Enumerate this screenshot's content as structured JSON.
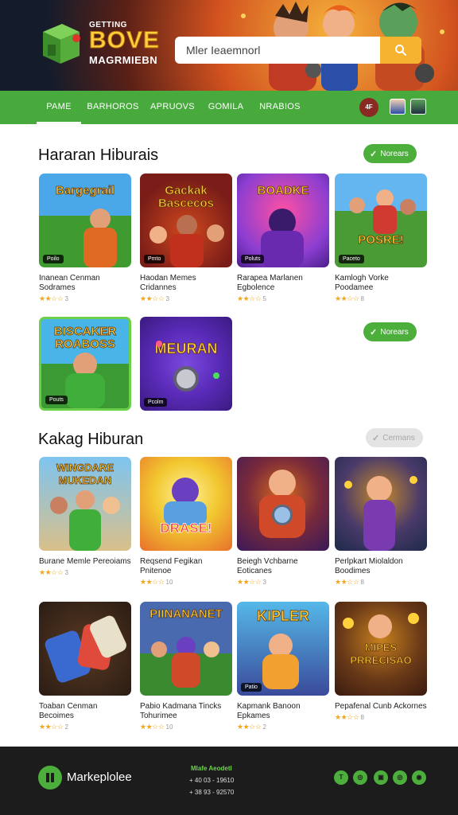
{
  "header": {
    "logo_small": "GETTING",
    "logo_big": "BOVE",
    "logo_sub": "MAGRMIEBN",
    "search_placeholder": "Mler Ieaemnorl"
  },
  "nav": {
    "items": [
      {
        "label": "PAME",
        "active": true
      },
      {
        "label": "BARHOROS",
        "active": false
      },
      {
        "label": "APRUOVS",
        "active": false
      },
      {
        "label": "GOMILA",
        "active": false
      },
      {
        "label": "NRABIOS",
        "active": false
      }
    ],
    "badge": "4F"
  },
  "section1": {
    "title": "Hararan Hiburais",
    "pill_label": "Norears",
    "pill2_label": "Norears",
    "cards": [
      {
        "thumb_title": "Bargegrail",
        "tag": "Poilo",
        "name": "Inanean Cenman Sodrames",
        "rating": "3",
        "colors": [
          "#4aa8e8",
          "#3f9b2f"
        ]
      },
      {
        "thumb_title": "Gackak Bascecos",
        "tag": "Pmto",
        "name": "Haodan Memes Cridannes",
        "rating": "3",
        "colors": [
          "#7a1d18",
          "#d0481d"
        ]
      },
      {
        "thumb_title": "BOADKE",
        "tag": "Poluts",
        "name": "Rarapea Marlanen Egbolence",
        "rating": "5",
        "colors": [
          "#8b3ed1",
          "#ff4fa3"
        ]
      },
      {
        "thumb_title": "POSRE!",
        "tag": "Paceto",
        "name": "Kamlogh Vorke Poodamee",
        "rating": "8",
        "colors": [
          "#64b6f0",
          "#4a9a35"
        ]
      },
      {
        "thumb_title": "BISCAKER ROABOSS",
        "tag": "Pouts",
        "name": "",
        "rating": "",
        "colors": [
          "#48b4e8",
          "#3c9a34"
        ]
      },
      {
        "thumb_title": "MEURAN",
        "tag": "Pcolm",
        "name": "",
        "rating": "",
        "colors": [
          "#5a2bb8",
          "#3a1a80"
        ]
      }
    ]
  },
  "section2": {
    "title": "Kakag Hiburan",
    "pill_label": "Cermans",
    "cards": [
      {
        "thumb_title": "WINGDARE MUKEDAN",
        "tag": "",
        "name": "Burane Memle Pereoiams",
        "rating": "3",
        "colors": [
          "#7ec4f0",
          "#d9c08a"
        ]
      },
      {
        "thumb_title": "DRASE!",
        "tag": "",
        "name": "Reqsend Fegikan Pnitenoe",
        "rating": "10",
        "colors": [
          "#f2c830",
          "#e8702a"
        ]
      },
      {
        "thumb_title": "",
        "tag": "",
        "name": "Beiegh Vchbarne Eoticanes",
        "rating": "3",
        "colors": [
          "#3a1a5a",
          "#d46a1e"
        ]
      },
      {
        "thumb_title": "",
        "tag": "",
        "name": "Perlpkart Miolaldon Boodimes",
        "rating": "8",
        "colors": [
          "#1d2a4a",
          "#c48a2a"
        ]
      },
      {
        "thumb_title": "",
        "tag": "",
        "name": "Toaban Cenman Becoimes",
        "rating": "2",
        "colors": [
          "#2a1c14",
          "#5a3a22"
        ]
      },
      {
        "thumb_title": "PIINANANET",
        "tag": "",
        "name": "Pabio Kadmana Tincks Tohurimee",
        "rating": "10",
        "colors": [
          "#4a6ab0",
          "#3a8a30"
        ]
      },
      {
        "thumb_title": "KIPLER",
        "tag": "Patio",
        "name": "Kapmank Banoon Epkames",
        "rating": "2",
        "colors": [
          "#55b8e8",
          "#3a4a9a"
        ]
      },
      {
        "thumb_title": "MIPES PRRECISAO",
        "tag": "",
        "name": "Pepafenal Cunb Ackornes",
        "rating": "8",
        "colors": [
          "#3a1a10",
          "#c8801e"
        ]
      }
    ]
  },
  "footer": {
    "brand": "Markeplolee",
    "contact_title": "Mlafe Aeodetl",
    "phone1": "+ 40 03 - 19610",
    "phone2": "+ 38 93 - 92570"
  },
  "colors": {
    "accent_green": "#4caf3c",
    "nav_green": "#48a93c",
    "footer_bg": "#1c1c1c",
    "star": "#f2a61e",
    "search_button": "#f5b330"
  }
}
